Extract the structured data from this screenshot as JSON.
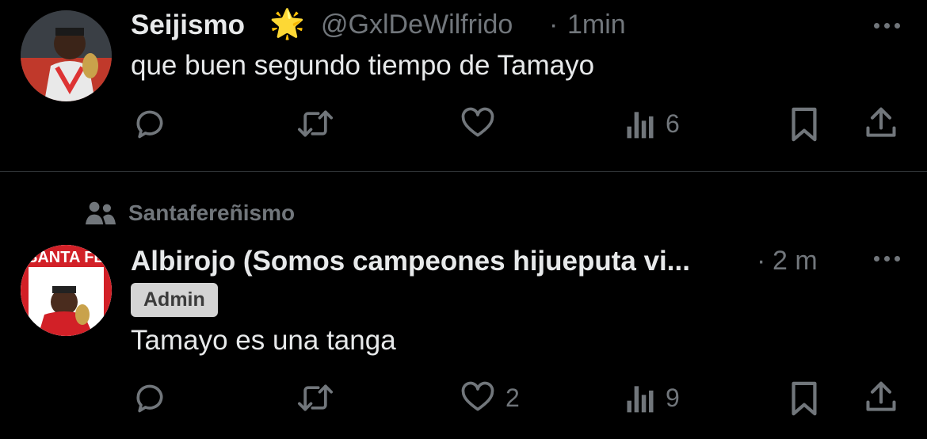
{
  "tweet1": {
    "name": "Seijismo",
    "emoji": "🌟",
    "handle": "@GxlDeWilfrido",
    "time_sep": "·",
    "time": "1min",
    "text": "que buen segundo tiempo de Tamayo",
    "stats": {
      "replies": "",
      "reposts": "",
      "likes": "",
      "views": "6"
    }
  },
  "tweet2": {
    "community": "Santafereñismo",
    "name": "Albirojo (Somos campeones hijueputa vi...",
    "time_sep": "·",
    "time": "2 m",
    "badge": "Admin",
    "avatar_text": "SANTA FE",
    "text": "Tamayo es una tanga",
    "stats": {
      "replies": "",
      "reposts": "",
      "likes": "2",
      "views": "9"
    }
  },
  "icons": [
    "reply-icon",
    "repost-icon",
    "like-icon",
    "views-icon",
    "bookmark-icon",
    "share-icon",
    "more-icon",
    "community-icon",
    "star-emoji"
  ],
  "colors": {
    "background": "#000000",
    "text": "#e7e9ea",
    "muted": "#71767b",
    "badge_bg": "#d4d4d4",
    "divider": "#2f3336"
  }
}
